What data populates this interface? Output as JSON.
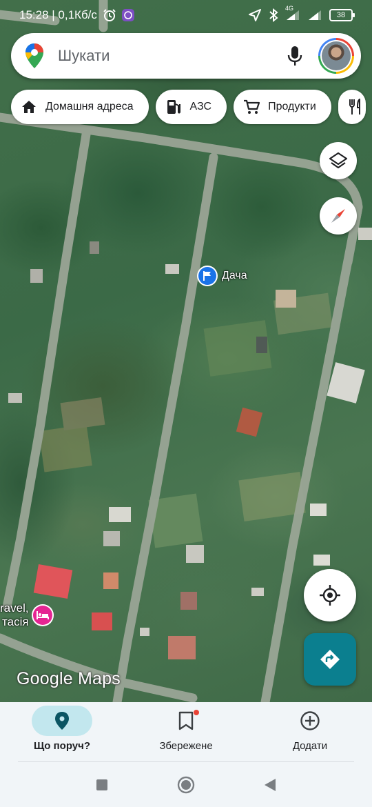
{
  "status_bar": {
    "time_speed": "15:28 | 0,1Кб/с",
    "network_type": "4G",
    "battery": "38",
    "icons": [
      "alarm-icon",
      "viber-icon",
      "location-icon",
      "bluetooth-icon",
      "signal-icon",
      "battery-icon"
    ]
  },
  "search": {
    "placeholder": "Шукати",
    "icons": [
      "google-maps-pin-icon",
      "microphone-icon",
      "account-avatar"
    ]
  },
  "chips": [
    {
      "label": "Домашня адреса",
      "icon": "home-icon"
    },
    {
      "label": "АЗС",
      "icon": "gas-station-icon"
    },
    {
      "label": "Продукти",
      "icon": "shopping-cart-icon"
    },
    {
      "label": "",
      "icon": "restaurant-icon"
    }
  ],
  "map": {
    "pin_label": "Дача",
    "hotel_label_line1": "ravel,",
    "hotel_label_line2": "тасія",
    "watermark": "Google Maps"
  },
  "bottom_nav": {
    "tabs": [
      {
        "label": "Що поруч?",
        "icon": "location-pin-icon",
        "active": true
      },
      {
        "label": "Збережене",
        "icon": "bookmark-icon",
        "active": false,
        "badge": true
      },
      {
        "label": "Додати",
        "icon": "add-circle-icon",
        "active": false
      }
    ]
  },
  "system_nav": [
    "recents-button",
    "home-button",
    "back-button"
  ],
  "colors": {
    "accent": "#0b7f8f",
    "active_tab": "#c2e7ee",
    "pin_blue": "#1a73e8",
    "hotel_pink": "#e52592",
    "badge_red": "#ea4335"
  }
}
